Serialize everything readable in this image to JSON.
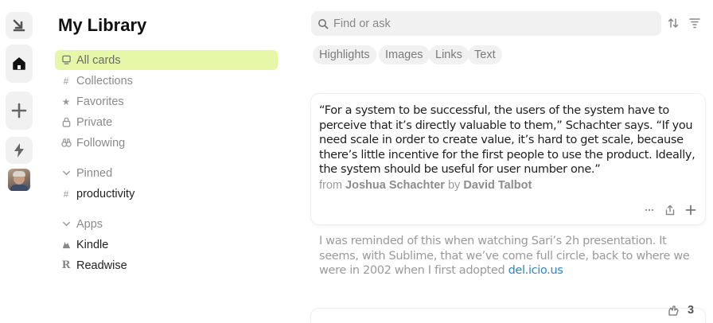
{
  "rail": {
    "items": [
      {
        "name": "import-icon"
      },
      {
        "name": "home-icon"
      },
      {
        "name": "add-icon"
      },
      {
        "name": "lightning-icon"
      },
      {
        "name": "avatar"
      }
    ]
  },
  "sidebar": {
    "title": "My Library",
    "items": [
      {
        "label": "All cards",
        "icon": "card-icon",
        "active": true
      },
      {
        "label": "Collections",
        "icon": "hash-icon"
      },
      {
        "label": "Favorites",
        "icon": "star-icon"
      },
      {
        "label": "Private",
        "icon": "lock-icon"
      },
      {
        "label": "Following",
        "icon": "binoculars-icon"
      }
    ],
    "pinned_label": "Pinned",
    "pinned": [
      {
        "label": "productivity",
        "icon": "hash-icon"
      }
    ],
    "apps_label": "Apps",
    "apps": [
      {
        "label": "Kindle",
        "icon": "kindle-icon"
      },
      {
        "label": "Readwise",
        "icon": "readwise-icon"
      }
    ]
  },
  "search": {
    "placeholder": "Find or ask"
  },
  "filters": [
    "Highlights",
    "Images",
    "Links",
    "Text"
  ],
  "card": {
    "quote": "“For a system to be successful, the users of the system have to perceive that it’s directly valuable to them,” Schachter says. “If you need scale in order to create value, it’s hard to get scale, because there’s little incentive for the first people to use the product. Ideally, the system should be useful for user number one.”",
    "from_label": "from",
    "source_title": "Joshua Schachter",
    "by_label": "by",
    "author": "David Talbot"
  },
  "note": {
    "text": "I was reminded of this when watching Sari’s 2h presentation. It seems, with Sublime, that we’ve come full circle, back to where we were in 2002 when I first adopted ",
    "link_text": "del.icio.us"
  },
  "footer": {
    "count": "3"
  }
}
